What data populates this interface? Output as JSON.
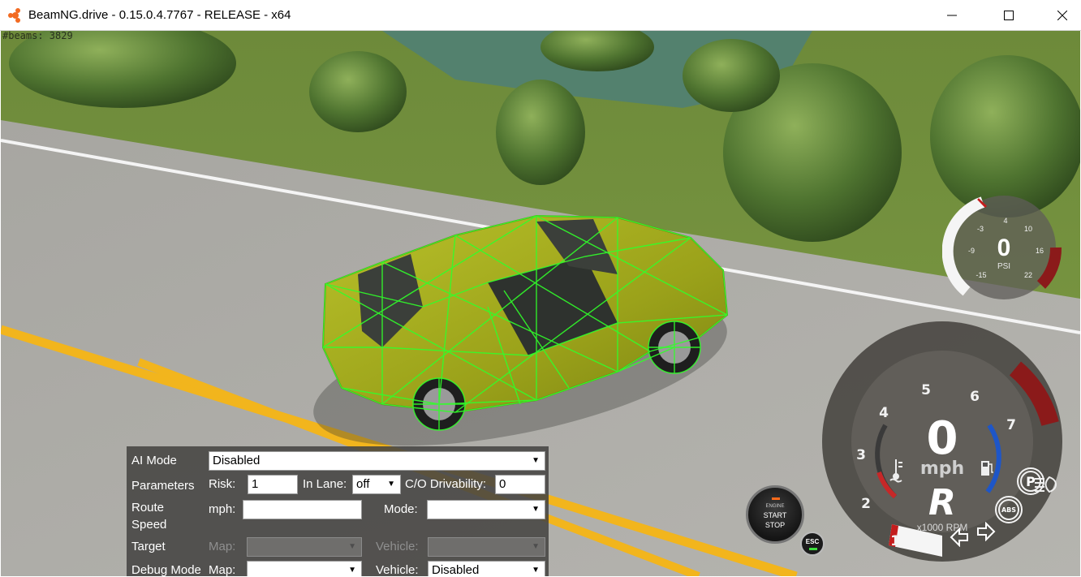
{
  "window": {
    "title": "BeamNG.drive - 0.15.0.4.7767 - RELEASE - x64",
    "controls": [
      "minimize",
      "maximize",
      "close"
    ]
  },
  "overlay": {
    "beams_counter": "#beams: 3829"
  },
  "ai_panel": {
    "ai_mode_label": "AI Mode",
    "ai_mode_value": "Disabled",
    "parameters_label": "Parameters",
    "risk_label": "Risk:",
    "risk_value": "1",
    "in_lane_label": "In Lane:",
    "in_lane_value": "off",
    "co_drivability_label": "C/O Drivability:",
    "co_drivability_value": "0",
    "route_speed_label_1": "Route",
    "route_speed_label_2": "Speed",
    "mph_label": "mph:",
    "mph_value": "",
    "mode_label": "Mode:",
    "mode_value": "",
    "target_label": "Target",
    "target_map_label": "Map:",
    "target_vehicle_label": "Vehicle:",
    "debug_mode_label": "Debug Mode",
    "debug_map_label": "Map:",
    "debug_map_value": "",
    "debug_vehicle_label": "Vehicle:",
    "debug_vehicle_value": "Disabled"
  },
  "turbo_gauge": {
    "value": "0",
    "unit": "PSI",
    "ticks": [
      "-3",
      "4",
      "10",
      "16",
      "22",
      "-9",
      "-15"
    ]
  },
  "tachometer": {
    "speed": "0",
    "speed_unit": "mph",
    "gear": "R",
    "rpm_label": "x1000 RPM",
    "rpm_ticks": [
      "1",
      "2",
      "3",
      "4",
      "5",
      "6",
      "7"
    ],
    "rpm_value": 0,
    "temperature_level": 0.35,
    "fuel_level": 0.9
  },
  "indicators": {
    "parking_brake": "P",
    "abs": "ABS",
    "headlight_icon": "headlight-icon",
    "left_turn_icon": "arrow-left-icon",
    "right_turn_icon": "arrow-right-icon"
  },
  "engine_button": {
    "line1": "ENGINE",
    "line2": "START",
    "line3": "STOP"
  },
  "esc_button": {
    "label": "ESC"
  },
  "colors": {
    "vehicle": "#a6ad1a",
    "beams": "#31ff2a",
    "redline": "#8b1a1a",
    "temp_arc": "#c62828",
    "fuel_arc": "#1e56c8",
    "gauge_text": "#f2f2f2"
  }
}
